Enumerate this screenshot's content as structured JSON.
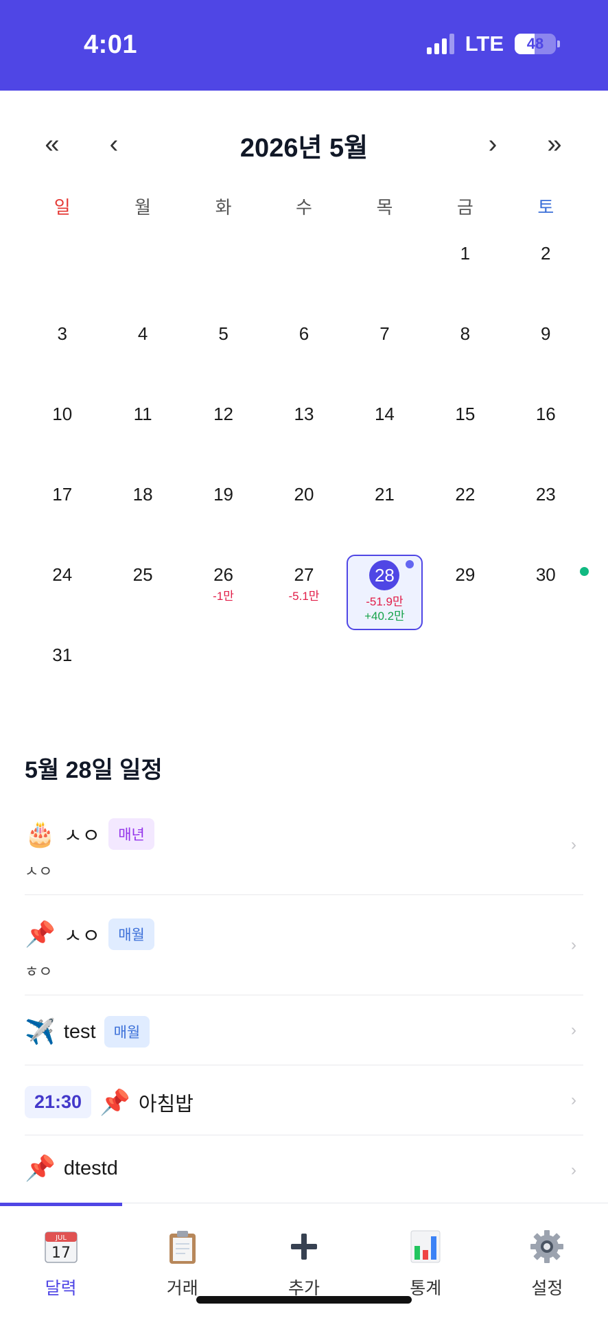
{
  "status": {
    "time": "4:01",
    "network": "LTE",
    "battery": "48",
    "battery_level": 0.48
  },
  "calendar": {
    "title": "2026년 5월",
    "nav": {
      "prev_year": "«",
      "prev_month": "‹",
      "next_month": "›",
      "next_year": "»"
    },
    "weekdays": [
      "일",
      "월",
      "화",
      "수",
      "목",
      "금",
      "토"
    ],
    "colors": {
      "sunday": "#e53935",
      "saturday": "#3b6fd8",
      "accent": "#4f46e5",
      "expense": "#e11d48",
      "income": "#16a34a"
    },
    "days": [
      "",
      "",
      "",
      "",
      "",
      "1",
      "2",
      "3",
      "4",
      "5",
      "6",
      "7",
      "8",
      "9",
      "10",
      "11",
      "12",
      "13",
      "14",
      "15",
      "16",
      "17",
      "18",
      "19",
      "20",
      "21",
      "22",
      "23",
      "24",
      "25",
      "26",
      "27",
      "28",
      "29",
      "30",
      "31"
    ],
    "amounts": {
      "d26": {
        "expense": "-1만"
      },
      "d27": {
        "expense": "-5.1만"
      },
      "d28": {
        "expense": "-51.9만",
        "income": "+40.2만"
      }
    },
    "selected_day": "28"
  },
  "schedule": {
    "title": "5월 28일 일정",
    "chevron": "›",
    "events": [
      {
        "icon": "🎂",
        "icon_name": "birthday-cake-icon",
        "title": "ㅅㅇ",
        "badge": "매년",
        "sub": "ㅅㅇ"
      },
      {
        "icon": "📌",
        "icon_name": "pushpin-icon",
        "title": "ㅅㅇ",
        "badge": "매월",
        "sub": "ㅎㅇ"
      },
      {
        "icon": "✈️",
        "icon_name": "airplane-icon",
        "title": "test",
        "badge": "매월"
      },
      {
        "time": "21:30",
        "icon": "📌",
        "icon_name": "pushpin-icon",
        "title": "아침밥"
      },
      {
        "icon": "📌",
        "icon_name": "pushpin-icon",
        "title": "dtestd"
      }
    ]
  },
  "tabbar": {
    "items": [
      {
        "label": "달력",
        "icon": "calendar-icon",
        "active": true
      },
      {
        "label": "거래",
        "icon": "clipboard-icon"
      },
      {
        "label": "추가",
        "icon": "plus-icon"
      },
      {
        "label": "통계",
        "icon": "bar-chart-icon"
      },
      {
        "label": "설정",
        "icon": "gear-icon"
      }
    ],
    "calendar_icon_month": "JUL",
    "calendar_icon_day": "17"
  }
}
